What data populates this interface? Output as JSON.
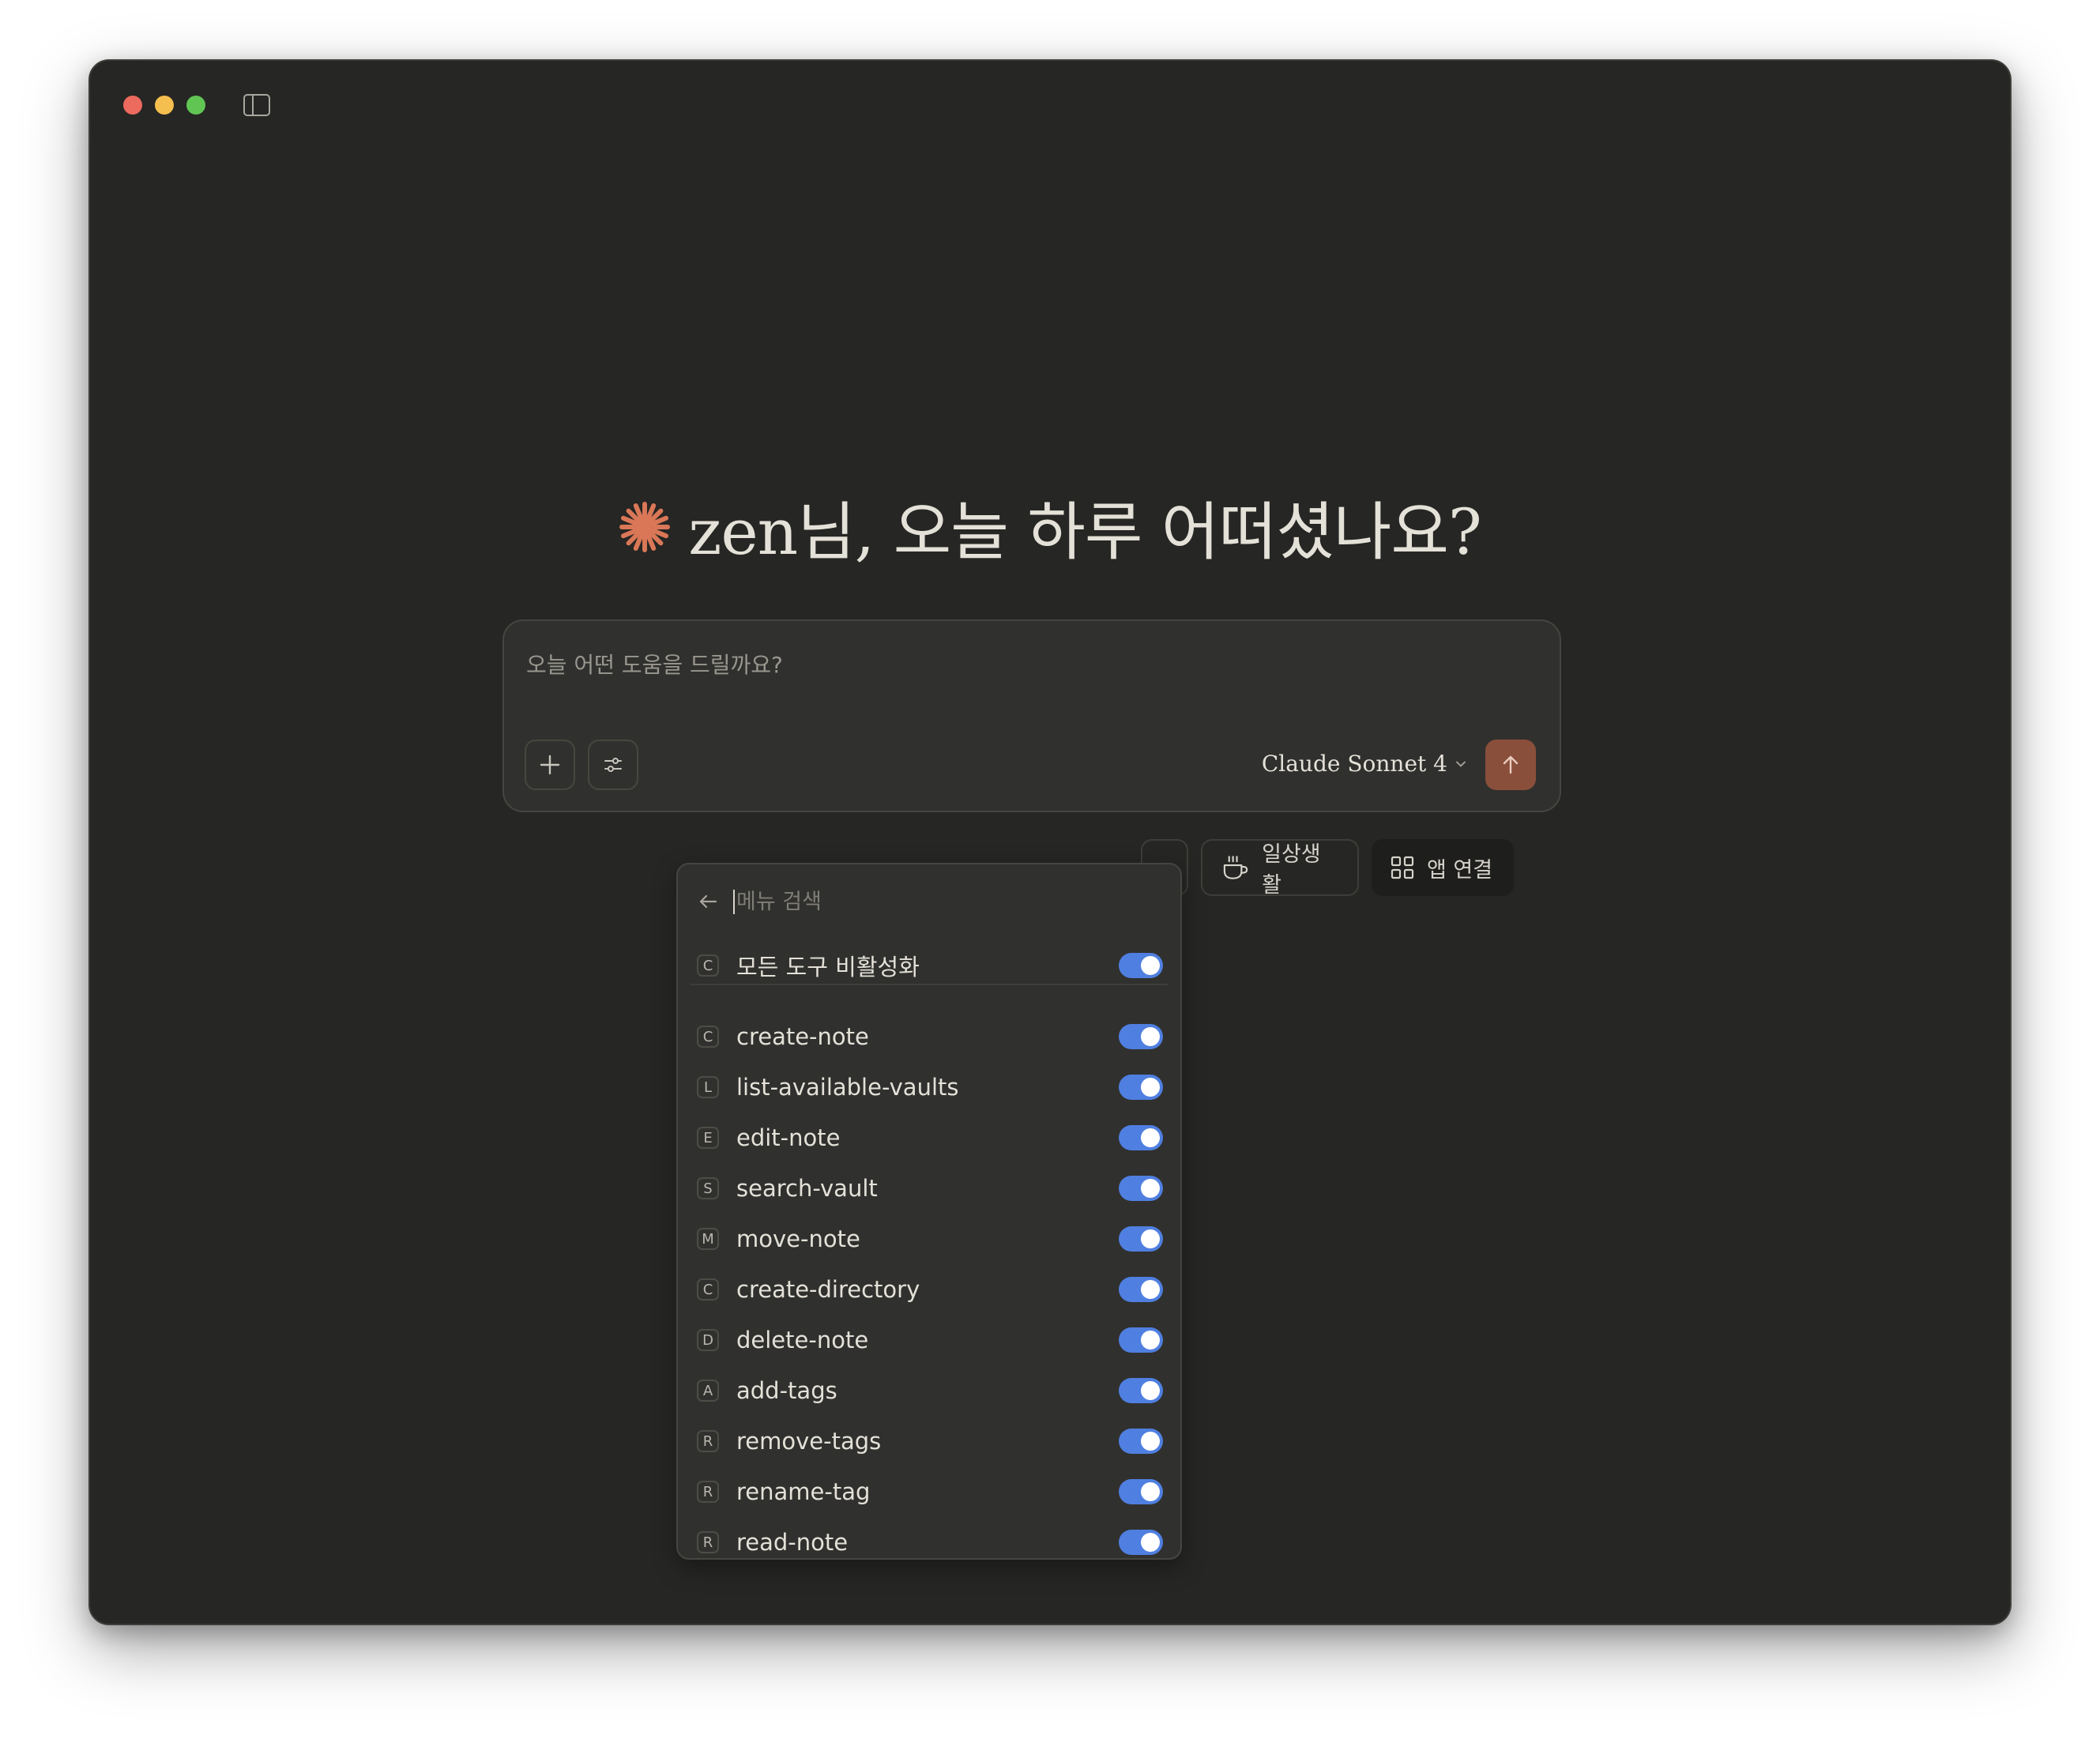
{
  "greeting": {
    "text": "zen님, 오늘 하루 어떠셨나요?",
    "accent_color": "#d97757"
  },
  "composer": {
    "placeholder": "오늘 어떤 도움을 드릴까요?",
    "model": "Claude Sonnet 4",
    "send_color": "#8a4f3a"
  },
  "chips": {
    "daily": "일상생활",
    "apps": "앱 연결"
  },
  "menu": {
    "search_placeholder": "메뉴 검색",
    "disable_all": {
      "badge": "C",
      "label": "모든 도구 비활성화",
      "enabled": true
    },
    "tools": [
      {
        "badge": "C",
        "label": "create-note",
        "enabled": true
      },
      {
        "badge": "L",
        "label": "list-available-vaults",
        "enabled": true
      },
      {
        "badge": "E",
        "label": "edit-note",
        "enabled": true
      },
      {
        "badge": "S",
        "label": "search-vault",
        "enabled": true
      },
      {
        "badge": "M",
        "label": "move-note",
        "enabled": true
      },
      {
        "badge": "C",
        "label": "create-directory",
        "enabled": true
      },
      {
        "badge": "D",
        "label": "delete-note",
        "enabled": true
      },
      {
        "badge": "A",
        "label": "add-tags",
        "enabled": true
      },
      {
        "badge": "R",
        "label": "remove-tags",
        "enabled": true
      },
      {
        "badge": "R",
        "label": "rename-tag",
        "enabled": true
      },
      {
        "badge": "R",
        "label": "read-note",
        "enabled": true
      }
    ],
    "toggle_color": "#4f7fe0"
  }
}
